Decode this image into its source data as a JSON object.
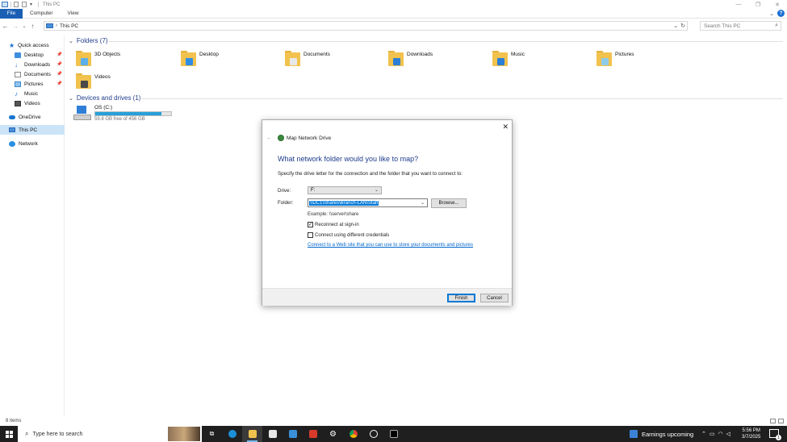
{
  "window": {
    "title": "This PC",
    "controls": [
      "—",
      "❐",
      "✕"
    ]
  },
  "ribbon": {
    "file": "File",
    "tabs": [
      "Computer",
      "View"
    ]
  },
  "address": {
    "path": "This PC",
    "search_placeholder": "Search This PC"
  },
  "sidebar": {
    "quick_access": "Quick access",
    "items": [
      {
        "label": "Desktop",
        "pinned": true
      },
      {
        "label": "Downloads",
        "pinned": true
      },
      {
        "label": "Documents",
        "pinned": true
      },
      {
        "label": "Pictures",
        "pinned": true
      },
      {
        "label": "Music",
        "pinned": false
      },
      {
        "label": "Videos",
        "pinned": false
      }
    ],
    "onedrive": "OneDrive",
    "this_pc": "This PC",
    "network": "Network"
  },
  "main": {
    "folders_header": "Folders (7)",
    "folders": [
      {
        "label": "3D Objects",
        "badge_color": "#5ab0ec"
      },
      {
        "label": "Desktop",
        "badge_color": "#2e8ee6"
      },
      {
        "label": "Documents",
        "badge_color": "#e8e8e8"
      },
      {
        "label": "Downloads",
        "badge_color": "#2b7fd6"
      },
      {
        "label": "Music",
        "badge_color": "#2b7fd6"
      },
      {
        "label": "Pictures",
        "badge_color": "#8ecbe8"
      },
      {
        "label": "Videos",
        "badge_color": "#4a4a4a"
      }
    ],
    "devices_header": "Devices and drives (1)",
    "drive": {
      "name": "OS (C:)",
      "free": "59.8 GB free of 456 GB",
      "used_fraction": 0.869
    }
  },
  "status": {
    "items_count": "8 items"
  },
  "dialog": {
    "title": "Map Network Drive",
    "heading": "What network folder would you like to map?",
    "instructions": "Specify the drive letter for the connection and the folder that you want to connect to:",
    "drive_label": "Drive:",
    "drive_value": "F:",
    "folder_label": "Folder:",
    "folder_value": "\\\\DC1\\Shares\\Branch-LAN\\Staff",
    "browse": "Browse...",
    "example": "Example: \\\\server\\share",
    "reconnect": "Reconnect at sign-in",
    "reconnect_checked": true,
    "credentials": "Connect using different credentials",
    "credentials_checked": false,
    "link": "Connect to a Web site that you can use to store your documents and pictures",
    "finish": "Finish",
    "cancel": "Cancel"
  },
  "taskbar": {
    "search_placeholder": "Type here to search",
    "weather": "Earnings upcoming",
    "time": "5:56 PM",
    "date": "3/7/2025",
    "notifications": "1"
  }
}
